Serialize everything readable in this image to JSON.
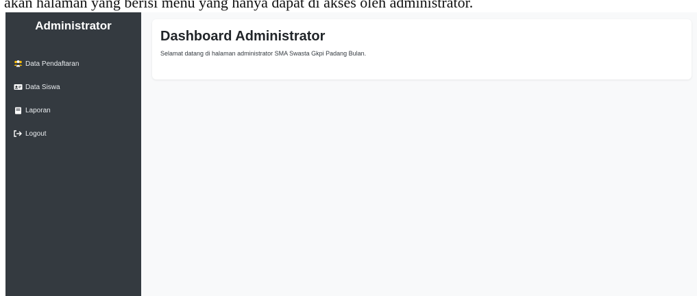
{
  "caption": "akan halaman yang berisi menu yang hanya dapat di akses oleh administrator.",
  "sidebar": {
    "title": "Administrator",
    "items": [
      {
        "label": "Data Pendaftaran",
        "icon": "users-icon"
      },
      {
        "label": "Data Siswa",
        "icon": "id-card-icon"
      },
      {
        "label": "Laporan",
        "icon": "book-icon"
      },
      {
        "label": "Logout",
        "icon": "logout-icon"
      }
    ]
  },
  "main": {
    "title": "Dashboard Administrator",
    "description": "Selamat datang di halaman administrator SMA Swasta Gkpi Padang Bulan."
  },
  "colors": {
    "sidebar_bg": "#343a40",
    "content_bg": "#f8f9fa",
    "card_bg": "#ffffff"
  }
}
